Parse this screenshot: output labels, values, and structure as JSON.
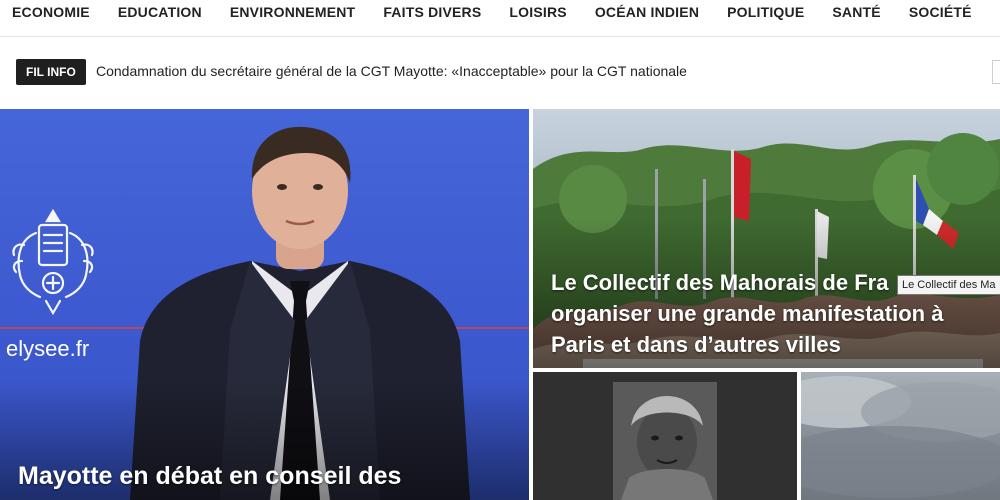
{
  "nav": {
    "items": [
      "ECONOMIE",
      "EDUCATION",
      "ENVIRONNEMENT",
      "FAITS DIVERS",
      "LOISIRS",
      "OCÉAN INDIEN",
      "POLITIQUE",
      "SANTÉ",
      "SOCIÉTÉ"
    ]
  },
  "ticker": {
    "badge": "FIL INFO",
    "headline": "Condamnation du secrétaire général de la CGT Mayotte: «Inacceptable» pour la CGT nationale"
  },
  "hero": {
    "brand": "elysee.fr",
    "title": "Mayotte en débat en conseil des"
  },
  "card_top": {
    "title_line1": "Le Collectif des Mahorais de Fra",
    "title_line2": "organiser une grande manifestation à",
    "title_line3": "Paris et dans d’autres villes",
    "tooltip": "Le Collectif des Ma"
  },
  "colors": {
    "accent_blue": "#3e5ad0",
    "flag_red": "#c8202a",
    "badge_bg": "#1f1f1f"
  }
}
